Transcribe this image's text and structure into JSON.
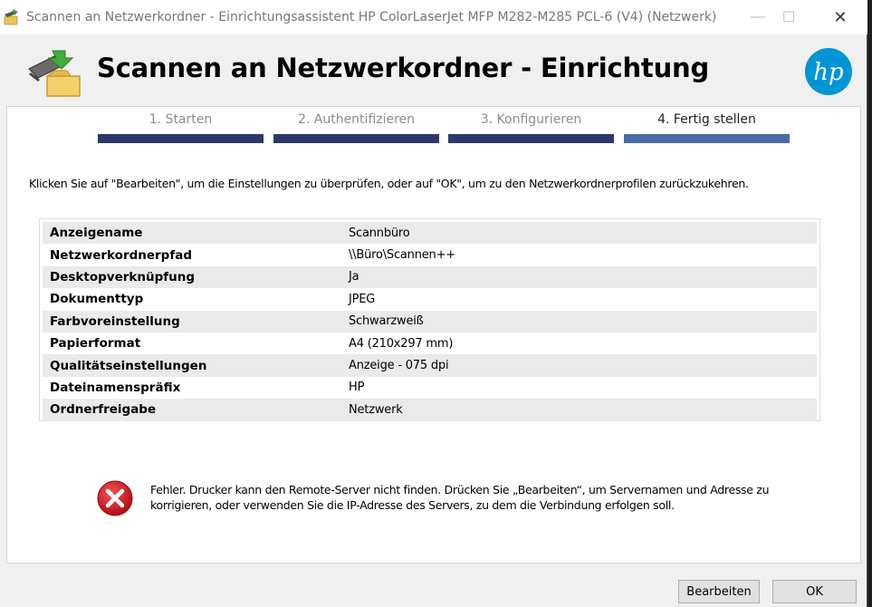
{
  "window": {
    "title": "Scannen an Netzwerkordner - Einrichtungsassistent  HP ColorLaserJet MFP M282-M285 PCL-6 (V4) (Netzwerk)",
    "controls": {
      "minimize": "—",
      "maximize": "☐",
      "close": "✕"
    }
  },
  "header": {
    "heading": "Scannen an Netzwerkordner - Einrichtung",
    "logo_text": "hp"
  },
  "steps": [
    {
      "label": "1. Starten",
      "active": false
    },
    {
      "label": "2. Authentifizieren",
      "active": false
    },
    {
      "label": "3. Konfigurieren",
      "active": false
    },
    {
      "label": "4. Fertig stellen",
      "active": true
    }
  ],
  "instructions": "Klicken Sie auf \"Bearbeiten\", um die Einstellungen zu überprüfen, oder auf \"OK\", um zu den Netzwerkordnerprofilen zurückzukehren.",
  "summary": [
    {
      "key": "Anzeigename",
      "value": "Scannbüro"
    },
    {
      "key": "Netzwerkordnerpfad",
      "value": "\\\\Büro\\Scannen++"
    },
    {
      "key": "Desktopverknüpfung",
      "value": "Ja"
    },
    {
      "key": "Dokumenttyp",
      "value": "JPEG"
    },
    {
      "key": "Farbvoreinstellung",
      "value": "Schwarzweiß"
    },
    {
      "key": "Papierformat",
      "value": "A4 (210x297 mm)"
    },
    {
      "key": "Qualitätseinstellungen",
      "value": "Anzeige - 075 dpi"
    },
    {
      "key": "Dateinamenspräfix",
      "value": "HP"
    },
    {
      "key": "Ordnerfreigabe",
      "value": "Netzwerk"
    }
  ],
  "error": {
    "icon": "error-icon",
    "text": "Fehler. Drucker kann den Remote-Server nicht finden. Drücken Sie „Bearbeiten“, um Servernamen und Adresse zu korrigieren, oder verwenden Sie die IP-Adresse des Servers, zu dem die Verbindung erfolgen soll."
  },
  "buttons": {
    "edit": "Bearbeiten",
    "ok": "OK"
  },
  "colors": {
    "step_bar": "#2b3a6b",
    "step_bar_active": "#4a6ba8",
    "hp_blue": "#0096d6",
    "error_red": "#c8101e"
  }
}
